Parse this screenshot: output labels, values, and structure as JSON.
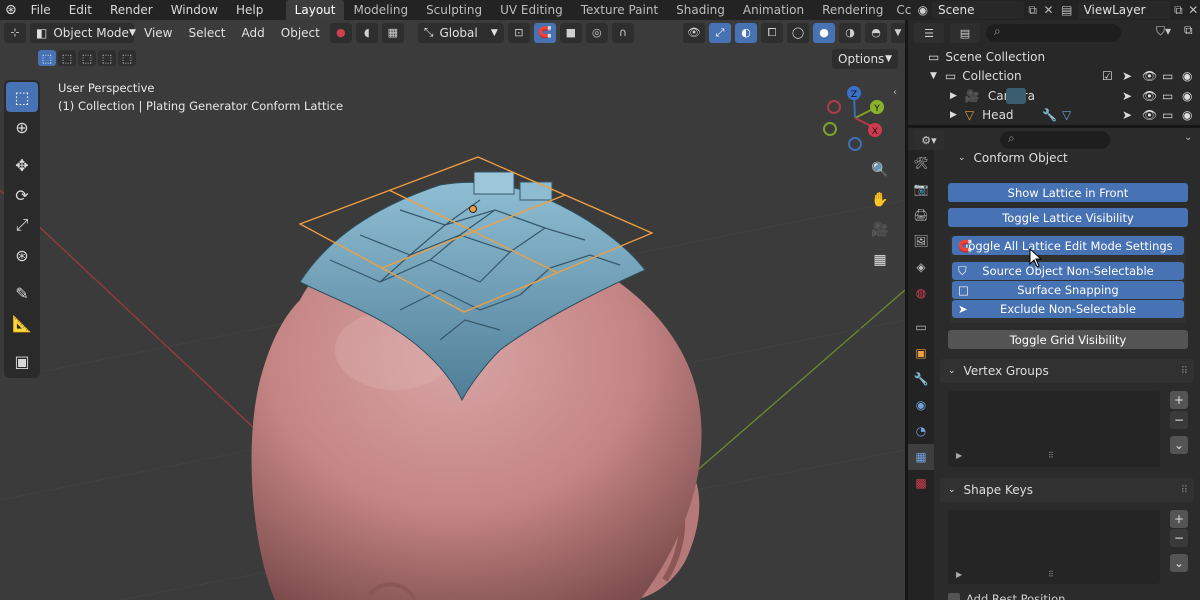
{
  "app": {
    "title": "Blender"
  },
  "menu": [
    "File",
    "Edit",
    "Render",
    "Window",
    "Help"
  ],
  "workspaces": {
    "active": "Layout",
    "others": [
      "Modeling",
      "Sculpting",
      "UV Editing",
      "Texture Paint",
      "Shading",
      "Animation",
      "Rendering",
      "Cc"
    ]
  },
  "scene": {
    "label": "Scene",
    "view_layer": "ViewLayer"
  },
  "viewport": {
    "mode": "Object Mode",
    "menus": [
      "View",
      "Select",
      "Add",
      "Object"
    ],
    "orientation": "Global",
    "options_label": "Options",
    "perspective": "User Perspective",
    "context": "(1) Collection | Plating Generator Conform Lattice",
    "gizmo_axes": {
      "x": "X",
      "y": "Y",
      "z": "Z"
    }
  },
  "outliner": {
    "root": "Scene Collection",
    "collection": "Collection",
    "items": [
      "Camera",
      "Head"
    ]
  },
  "properties": {
    "panel_title": "Conform Object",
    "buttons": {
      "show_lattice_front": "Show Lattice in Front",
      "toggle_lattice_visibility": "Toggle Lattice Visibility",
      "toggle_all_edit": "Toggle All Lattice Edit Mode Settings",
      "source_non_selectable": "Source Object Non-Selectable",
      "surface_snapping": "Surface Snapping",
      "exclude_non_selectable": "Exclude Non-Selectable",
      "toggle_grid": "Toggle Grid Visibility"
    },
    "vertex_groups": "Vertex Groups",
    "shape_keys": "Shape Keys",
    "add_rest_position": "Add Rest Position"
  },
  "colors": {
    "accent": "#4772b3",
    "lattice": "#f0a040",
    "plating": "#6a9bb3",
    "skin": "#c98a8a",
    "bg": "#3b3b3b"
  }
}
